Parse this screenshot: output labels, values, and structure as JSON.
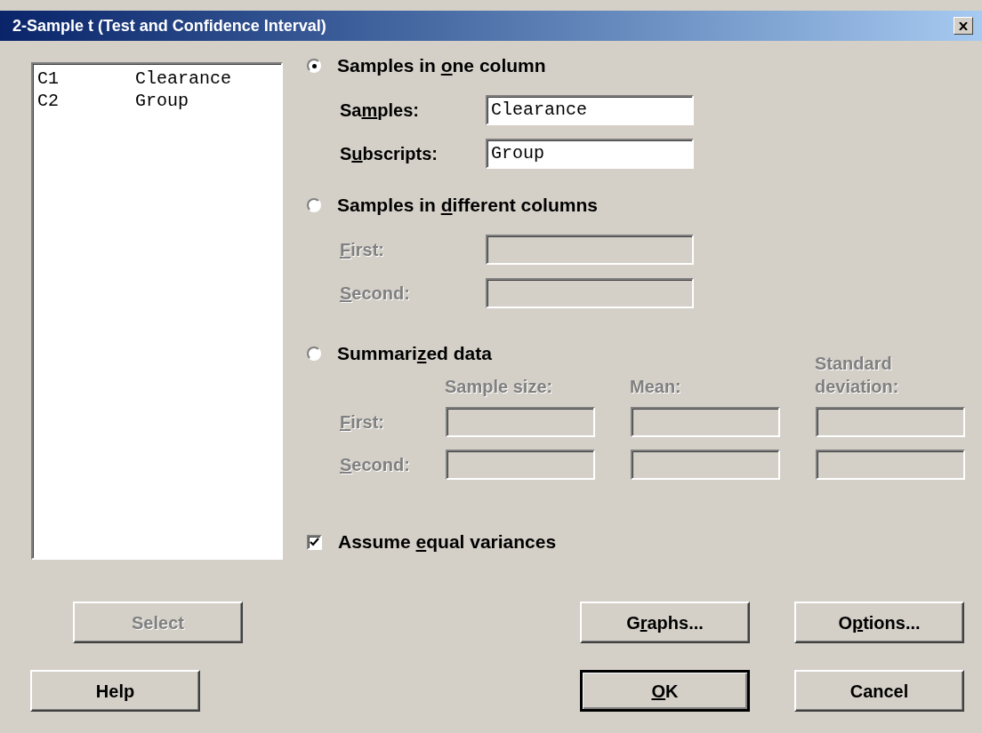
{
  "window": {
    "title": "2-Sample t (Test and Confidence Interval)"
  },
  "variables": [
    {
      "column": "C1",
      "name": "Clearance"
    },
    {
      "column": "C2",
      "name": "Group"
    }
  ],
  "options": [
    {
      "kind": "fields",
      "selected": true,
      "label": {
        "before": "Samples in ",
        "key": "o",
        "after": "ne column"
      },
      "fields": [
        {
          "label": {
            "before": "Sa",
            "key": "m",
            "after": "ples:"
          },
          "value": "Clearance",
          "disabled": false
        },
        {
          "label": {
            "before": "S",
            "key": "u",
            "after": "bscripts:"
          },
          "value": "Group",
          "disabled": false
        }
      ]
    },
    {
      "kind": "fields",
      "selected": false,
      "label": {
        "before": "Samples in ",
        "key": "d",
        "after": "ifferent columns"
      },
      "fields": [
        {
          "label": {
            "key": "F",
            "after": "irst:"
          },
          "disabled": true
        },
        {
          "label": {
            "key": "S",
            "after": "econd:"
          },
          "disabled": true
        }
      ]
    },
    {
      "kind": "table",
      "selected": false,
      "label": {
        "before": "Summari",
        "key": "z",
        "after": "ed data"
      },
      "disabled": true,
      "columns": [
        "Sample size:",
        "Mean:",
        "Standard deviation:"
      ],
      "rows": [
        {
          "label": {
            "key": "F",
            "after": "irst:"
          }
        },
        {
          "label": {
            "key": "S",
            "after": "econd:"
          }
        }
      ]
    }
  ],
  "equal_variances": {
    "checked": true,
    "label": {
      "before": "Assume ",
      "key": "e",
      "after": "qual variances"
    }
  },
  "buttons": [
    {
      "label": {
        "before": "Select"
      },
      "disabled": true
    },
    {
      "label": {
        "before": "G",
        "key": "r",
        "after": "aphs..."
      },
      "disabled": false
    },
    {
      "label": {
        "before": "O",
        "key": "p",
        "after": "tions..."
      },
      "disabled": false
    },
    {
      "label": {
        "before": "Help"
      },
      "disabled": false
    },
    {
      "label": {
        "key": "O",
        "after": "K"
      },
      "disabled": false,
      "default": true
    },
    {
      "label": {
        "before": "Cancel"
      },
      "disabled": false
    }
  ]
}
